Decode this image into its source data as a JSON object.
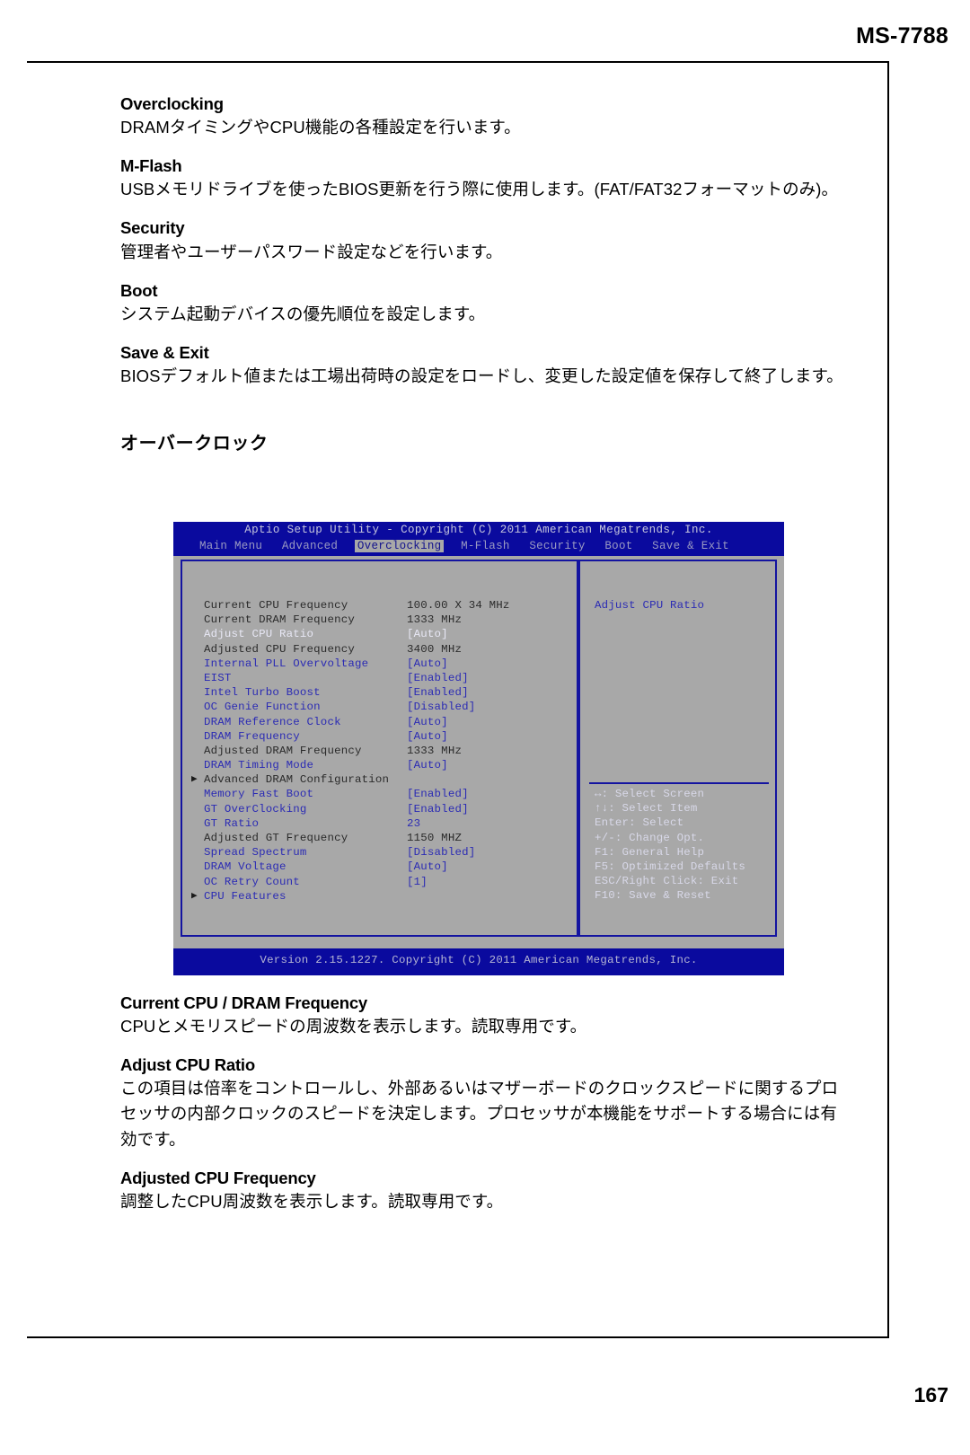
{
  "page": {
    "model": "MS-7788",
    "number": "167"
  },
  "sections_upper": [
    {
      "title": "Overclocking",
      "body": "DRAMタイミングやCPU機能の各種設定を行います。"
    },
    {
      "title": "M-Flash",
      "body": "USBメモリドライブを使ったBIOS更新を行う際に使用します。(FAT/FAT32フォーマットのみ)。"
    },
    {
      "title": "Security",
      "body": "管理者やユーザーパスワード設定などを行います。"
    },
    {
      "title": "Boot",
      "body": "システム起動デバイスの優先順位を設定します。"
    },
    {
      "title": "Save & Exit",
      "body": "BIOSデフォルト値または工場出荷時の設定をロードし、変更した設定値を保存して終了します。"
    }
  ],
  "figure_heading": "オーバークロック",
  "bios": {
    "title": "Aptio Setup Utility - Copyright (C) 2011 American Megatrends, Inc.",
    "menu": [
      {
        "label": "Main Menu",
        "active": false
      },
      {
        "label": "Advanced",
        "active": false
      },
      {
        "label": "Overclocking",
        "active": true
      },
      {
        "label": "M-Flash",
        "active": false
      },
      {
        "label": "Security",
        "active": false
      },
      {
        "label": "Boot",
        "active": false
      },
      {
        "label": "Save & Exit",
        "active": false
      }
    ],
    "settings": [
      {
        "label": "Current CPU Frequency",
        "value": "100.00 X 34 MHz",
        "style": "dark",
        "arrow": false
      },
      {
        "label": "Current DRAM Frequency",
        "value": "1333 MHz",
        "style": "dark",
        "arrow": false
      },
      {
        "label": "Adjust CPU Ratio",
        "value": "[Auto]",
        "style": "white",
        "arrow": false
      },
      {
        "label": "Adjusted CPU Frequency",
        "value": "3400 MHz",
        "style": "dark",
        "arrow": false
      },
      {
        "label": "Internal PLL Overvoltage",
        "value": "[Auto]",
        "style": "blue",
        "arrow": false
      },
      {
        "label": "EIST",
        "value": "[Enabled]",
        "style": "blue",
        "arrow": false
      },
      {
        "label": "Intel Turbo Boost",
        "value": "[Enabled]",
        "style": "blue",
        "arrow": false
      },
      {
        "label": "OC Genie Function",
        "value": "[Disabled]",
        "style": "blue",
        "arrow": false
      },
      {
        "label": "DRAM Reference Clock",
        "value": "[Auto]",
        "style": "blue",
        "arrow": false
      },
      {
        "label": "DRAM Frequency",
        "value": "[Auto]",
        "style": "blue",
        "arrow": false
      },
      {
        "label": "Adjusted DRAM Frequency",
        "value": "1333 MHz",
        "style": "dark",
        "arrow": false
      },
      {
        "label": "DRAM Timing Mode",
        "value": "[Auto]",
        "style": "blue",
        "arrow": false
      },
      {
        "label": "Advanced DRAM Configuration",
        "value": "",
        "style": "dark",
        "arrow": true
      },
      {
        "label": "Memory Fast Boot",
        "value": "[Enabled]",
        "style": "blue",
        "arrow": false
      },
      {
        "label": "GT OverClocking",
        "value": "[Enabled]",
        "style": "blue",
        "arrow": false
      },
      {
        "label": "GT Ratio",
        "value": "23",
        "style": "blue",
        "arrow": false
      },
      {
        "label": "Adjusted GT Frequency",
        "value": "1150 MHZ",
        "style": "dark",
        "arrow": false
      },
      {
        "label": "Spread Spectrum",
        "value": "[Disabled]",
        "style": "blue",
        "arrow": false
      },
      {
        "label": "DRAM Voltage",
        "value": "[Auto]",
        "style": "blue",
        "arrow": false
      },
      {
        "label": "OC Retry Count",
        "value": "[1]",
        "style": "blue",
        "arrow": false
      },
      {
        "label": "CPU Features",
        "value": "",
        "style": "blue",
        "arrow": true
      }
    ],
    "help_text": "Adjust CPU Ratio",
    "keys": [
      "↔: Select Screen",
      "↑↓: Select Item",
      "Enter: Select",
      "+/-: Change Opt.",
      "F1: General Help",
      "F5: Optimized Defaults",
      "ESC/Right Click: Exit",
      "F10: Save & Reset"
    ],
    "footer": "Version 2.15.1227. Copyright (C) 2011 American Megatrends, Inc."
  },
  "sections_lower": [
    {
      "title": "Current CPU / DRAM Frequency",
      "body": "CPUとメモリスピードの周波数を表示します。読取専用です。"
    },
    {
      "title": "Adjust CPU Ratio",
      "body": "この項目は倍率をコントロールし、外部あるいはマザーボードのクロックスピードに関するプロセッサの内部クロックのスピードを決定します。プロセッサが本機能をサポートする場合には有効です。"
    },
    {
      "title": "Adjusted CPU Frequency",
      "body": "調整したCPU周波数を表示します。読取専用です。"
    }
  ]
}
